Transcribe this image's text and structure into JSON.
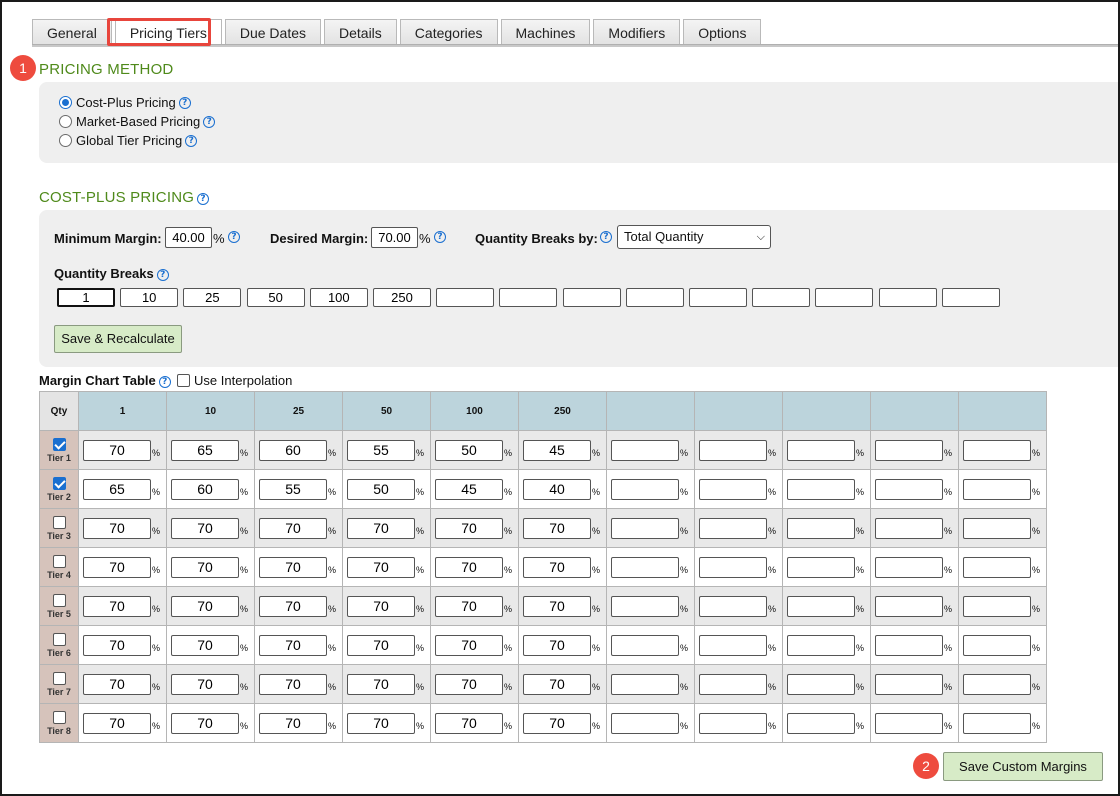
{
  "tabs": [
    "General",
    "Pricing Tiers",
    "Due Dates",
    "Details",
    "Categories",
    "Machines",
    "Modifiers",
    "Options"
  ],
  "active_tab": "Pricing Tiers",
  "badges": {
    "one": "1",
    "two": "2"
  },
  "pricing_method": {
    "title": "PRICING METHOD",
    "options": [
      {
        "label": "Cost-Plus Pricing",
        "checked": true
      },
      {
        "label": "Market-Based Pricing",
        "checked": false
      },
      {
        "label": "Global Tier Pricing",
        "checked": false
      }
    ]
  },
  "cost_plus": {
    "title": "COST-PLUS PRICING",
    "min_margin_label": "Minimum Margin:",
    "min_margin_value": "40.00",
    "desired_margin_label": "Desired Margin:",
    "desired_margin_value": "70.00",
    "percent": "%",
    "qty_breaks_by_label": "Quantity Breaks by:",
    "qty_breaks_by_value": "Total Quantity",
    "qty_breaks_label": "Quantity Breaks",
    "qty_breaks": [
      "1",
      "10",
      "25",
      "50",
      "100",
      "250",
      "",
      "",
      "",
      "",
      "",
      "",
      "",
      "",
      ""
    ],
    "save_button": "Save & Recalculate"
  },
  "margin_chart": {
    "title": "Margin Chart Table",
    "interpolation_label": "Use Interpolation",
    "qty_header": "Qty",
    "columns": [
      "1",
      "10",
      "25",
      "50",
      "100",
      "250",
      "",
      "",
      "",
      "",
      ""
    ],
    "tiers": [
      {
        "label": "Tier 1",
        "checked": true,
        "values": [
          "70",
          "65",
          "60",
          "55",
          "50",
          "45"
        ]
      },
      {
        "label": "Tier 2",
        "checked": true,
        "values": [
          "65",
          "60",
          "55",
          "50",
          "45",
          "40"
        ]
      },
      {
        "label": "Tier 3",
        "checked": false,
        "values": [
          "70",
          "70",
          "70",
          "70",
          "70",
          "70"
        ]
      },
      {
        "label": "Tier 4",
        "checked": false,
        "values": [
          "70",
          "70",
          "70",
          "70",
          "70",
          "70"
        ]
      },
      {
        "label": "Tier 5",
        "checked": false,
        "values": [
          "70",
          "70",
          "70",
          "70",
          "70",
          "70"
        ]
      },
      {
        "label": "Tier 6",
        "checked": false,
        "values": [
          "70",
          "70",
          "70",
          "70",
          "70",
          "70"
        ]
      },
      {
        "label": "Tier 7",
        "checked": false,
        "values": [
          "70",
          "70",
          "70",
          "70",
          "70",
          "70"
        ]
      },
      {
        "label": "Tier 8",
        "checked": false,
        "values": [
          "70",
          "70",
          "70",
          "70",
          "70",
          "70"
        ]
      }
    ],
    "percent": "%"
  },
  "save_custom_margins": "Save Custom Margins",
  "colors": {
    "section_green": "#4f8a1b",
    "badge_red": "#ee4b3e",
    "header_blue": "#bcd4dc",
    "tier_tan": "#d6c3bb",
    "button_green": "#d7ebc7"
  }
}
